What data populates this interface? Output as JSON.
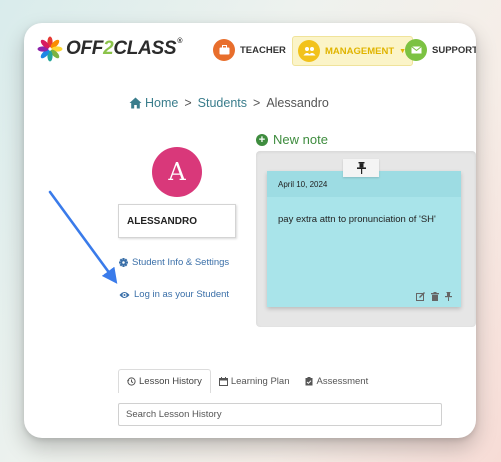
{
  "header": {
    "logo_prefix": "OFF",
    "logo_two": "2",
    "logo_suffix": "CLASS",
    "logo_reg": "®",
    "nav": {
      "teacher": "TEACHER",
      "management": "MANAGEMENT",
      "support": "SUPPORT"
    }
  },
  "breadcrumb": {
    "home": "Home",
    "separator": ">",
    "students": "Students",
    "current": "Alessandro"
  },
  "student": {
    "initial": "A",
    "name": "ALESSANDRO",
    "info_link": "Student Info & Settings",
    "login_link": "Log in as your Student"
  },
  "notes": {
    "new_note_label": "New note",
    "items": [
      {
        "date": "April 10, 2024",
        "text": "pay extra attn to pronunciation of 'SH'"
      }
    ]
  },
  "tabs": [
    {
      "label": "Lesson History"
    },
    {
      "label": "Learning Plan"
    },
    {
      "label": "Assessment"
    }
  ],
  "search": {
    "placeholder": "Search Lesson History"
  },
  "colors": {
    "avatar": "#d9387a",
    "link": "#3a6fa8",
    "new_note": "#3e8c3e",
    "sticky": "#a9e4ea",
    "teacher_icon": "#e86e2c",
    "management_icon": "#f2c21b",
    "support_icon": "#7cc242",
    "annotation_arrow": "#3a7bea"
  }
}
